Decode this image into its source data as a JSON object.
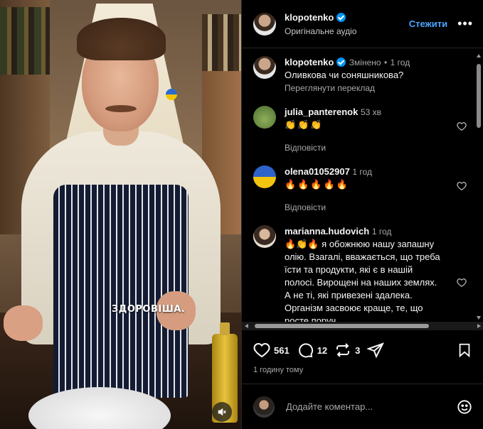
{
  "video": {
    "caption_overlay": "ЗДОРОВІША.",
    "mute_icon": "speaker-muted-icon"
  },
  "header": {
    "username": "klopotenko",
    "audio": "Оригінальне аудіо",
    "follow_label": "Стежити",
    "more_icon": "more-dots-icon"
  },
  "post_caption": {
    "username": "klopotenko",
    "edited": "Змінено",
    "separator": "•",
    "time": "1 год",
    "text": "Оливкова чи соняшникова?",
    "see_translation": "Переглянути переклад"
  },
  "comments": [
    {
      "username": "julia_panterenok",
      "time": "53 хв",
      "text": "👏👏👏",
      "reply_label": "Відповісти"
    },
    {
      "username": "olena01052907",
      "time": "1 год",
      "text": "🔥🔥🔥🔥🔥",
      "reply_label": "Відповісти"
    },
    {
      "username": "marianna.hudovich",
      "time": "1 год",
      "text": "🔥👏🔥 я обожнюю нашу запашну олію. Взагалі, вважається, що треба їсти та продукти, які є в нашій полосі. Вирощені на наших землях. А не ті, які привезені здалека. Організм засвоює краще, те, що росте поруч..."
    }
  ],
  "actions": {
    "likes": "561",
    "comments": "12",
    "reposts": "3"
  },
  "timestamp": "1 годину тому",
  "composer": {
    "placeholder": "Додайте коментар..."
  },
  "colors": {
    "accent": "#4aa4ff",
    "verified": "#0095f6",
    "background": "#000000",
    "muted_text": "#a8a8a8"
  }
}
